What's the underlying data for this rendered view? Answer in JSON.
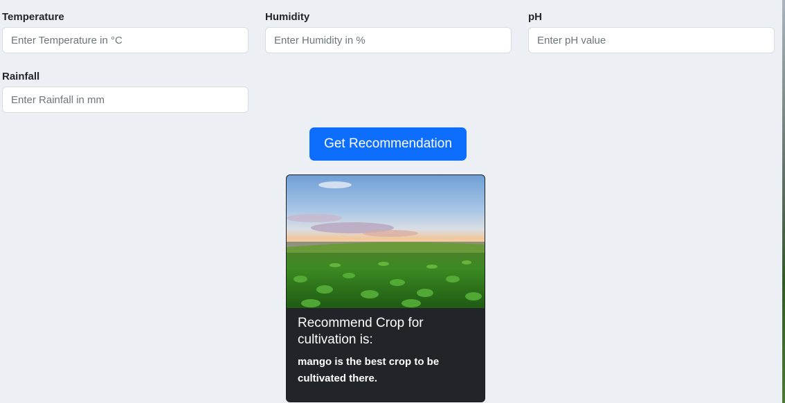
{
  "form": {
    "temperature": {
      "label": "Temperature",
      "placeholder": "Enter Temperature in °C"
    },
    "humidity": {
      "label": "Humidity",
      "placeholder": "Enter Humidity in %"
    },
    "ph": {
      "label": "pH",
      "placeholder": "Enter pH value"
    },
    "rainfall": {
      "label": "Rainfall",
      "placeholder": "Enter Rainfall in mm"
    }
  },
  "submit_button": {
    "label": "Get Recommendation",
    "color": "#0d6efd"
  },
  "result_card": {
    "image_icon": "crop-field-image",
    "title": "Recommend Crop for cultivation is:",
    "text": "mango is the best crop to be cultivated there.",
    "background": "#212529"
  },
  "colors": {
    "page_background": "#ecf0f5",
    "accent": "#0d6efd"
  }
}
